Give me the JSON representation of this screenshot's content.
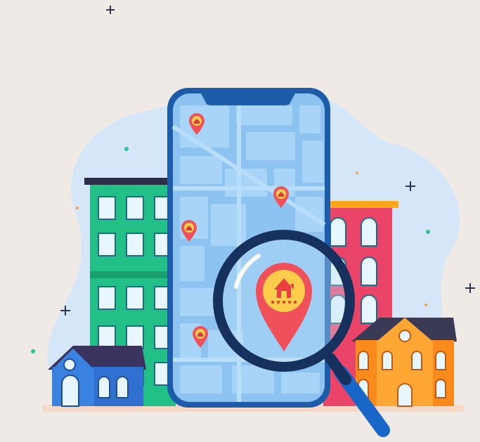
{
  "illustration": {
    "subject": "real-estate-map-search",
    "colors": {
      "background": "#efeae6",
      "blob": "#d4e6f8",
      "phone_frame": "#1c5ca8",
      "map_background": "#8dc3f1",
      "map_blocks": "#a8d4f8",
      "pin": "#f0505a",
      "pin_inner": "#ffcd4b",
      "green_building": "#22c086",
      "red_building": "#ea4469",
      "orange_building": "#fb8a1d",
      "blue_house": "#2f70d0",
      "lens_rim": "#17315e",
      "lens_handle": "#1766c8"
    },
    "icons": [
      "map-pin-icon",
      "house-icon",
      "star-icon",
      "magnifying-glass-icon",
      "plus-sparkle-icon"
    ],
    "featured_pin_rating_stars": 5
  }
}
